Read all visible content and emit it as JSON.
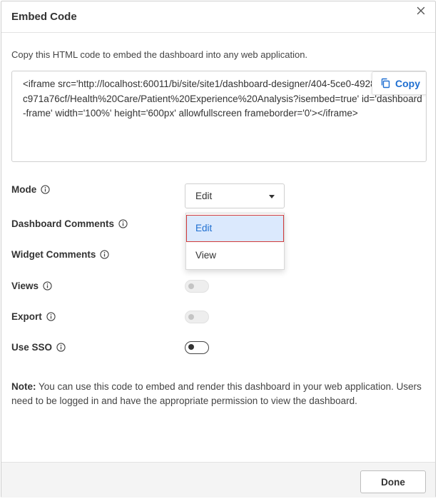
{
  "dialog": {
    "title": "Embed Code",
    "description": "Copy this HTML code to embed the dashboard into any web application.",
    "close_icon": "close-icon"
  },
  "code": {
    "text": "<iframe src='http://localhost:60011/bi/site/site1/dashboard-designer/404-5ce0-4928-b508-672c971a76cf/Health%20Care/Patient%20Experience%20Analysis?isembed=true' id='dashboard-frame' width='100%' height='600px' allowfullscreen frameborder='0'></iframe>",
    "copy_label": "Copy",
    "copy_icon": "copy-icon"
  },
  "options": {
    "mode": {
      "label": "Mode",
      "value": "Edit"
    },
    "dashboard_comments": {
      "label": "Dashboard Comments"
    },
    "widget_comments": {
      "label": "Widget Comments"
    },
    "views": {
      "label": "Views",
      "enabled": false,
      "on": false
    },
    "export": {
      "label": "Export",
      "enabled": false,
      "on": false
    },
    "use_sso": {
      "label": "Use SSO",
      "enabled": true,
      "on": false
    }
  },
  "mode_dropdown": {
    "items": [
      {
        "label": "Edit",
        "selected": true
      },
      {
        "label": "View",
        "selected": false
      }
    ]
  },
  "note": {
    "prefix": "Note:",
    "text": " You can use this code to embed and render this dashboard in your web application. Users need to be logged in and have the appropriate permission to view the dashboard."
  },
  "footer": {
    "done_label": "Done"
  },
  "colors": {
    "accent": "#1f6fd1",
    "selected_bg": "#dbe9fd",
    "highlight_border": "#d23b3b"
  }
}
